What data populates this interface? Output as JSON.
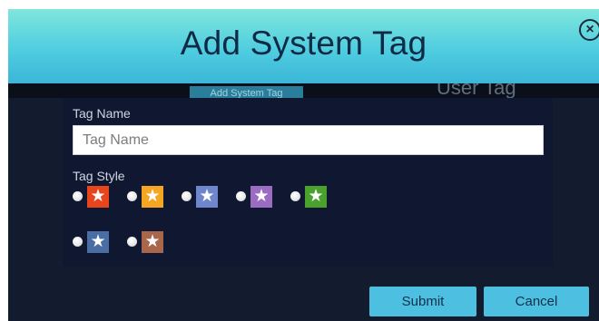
{
  "dialog": {
    "title": "Add System Tag",
    "close_symbol": "×",
    "header_gradient": [
      "#7fe6dc",
      "#3bb6d8"
    ],
    "background_color": "#121c2e"
  },
  "background_tabs": {
    "system_tag_label": "Add System Tag",
    "user_tag_label": "User Tag"
  },
  "form": {
    "tag_name_label": "Tag Name",
    "tag_name_placeholder": "Tag Name",
    "tag_name_value": "",
    "tag_style_label": "Tag Style",
    "styles": [
      {
        "name": "red-star",
        "color": "#e8451d",
        "icon": "star-icon"
      },
      {
        "name": "orange-star",
        "color": "#f5a623",
        "icon": "star-icon"
      },
      {
        "name": "lightblue-star",
        "color": "#6f86cc",
        "icon": "star-icon"
      },
      {
        "name": "purple-star",
        "color": "#9c6cc1",
        "icon": "star-icon"
      },
      {
        "name": "green-star",
        "color": "#4aa12c",
        "icon": "star-icon"
      },
      {
        "name": "steelblue-star",
        "color": "#4a6da3",
        "icon": "star-icon"
      },
      {
        "name": "brown-star",
        "color": "#a8674a",
        "icon": "star-icon"
      }
    ],
    "star_glyph": "★"
  },
  "footer": {
    "submit_label": "Submit",
    "cancel_label": "Cancel",
    "button_color": "#4dbfe0"
  }
}
